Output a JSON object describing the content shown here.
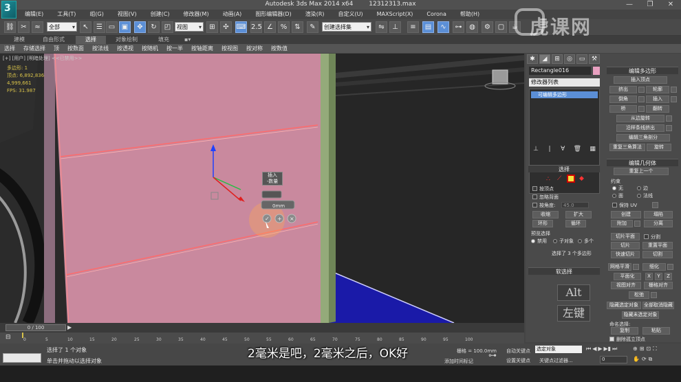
{
  "window": {
    "app_name": "Autodesk 3ds Max  2014 x64",
    "file_name": "12312313.max",
    "minimize": "—",
    "maximize": "❐",
    "close": "✕"
  },
  "menu": [
    "编辑(E)",
    "工具(T)",
    "组(G)",
    "视图(V)",
    "创建(C)",
    "修改器(M)",
    "动画(A)",
    "图形编辑器(D)",
    "渲染(R)",
    "自定义(U)",
    "MAXScript(X)",
    "Corona",
    "帮助(H)"
  ],
  "toolbar": {
    "selection_filter": "全部",
    "ref_coord": "视图",
    "named_selection": "创建选择集",
    "snap_label": "2.5"
  },
  "ribbon": {
    "tabs": [
      "建模",
      "自由形式",
      "选择",
      "对象绘制",
      "填充"
    ],
    "selected_tab": "选择",
    "tools": [
      "选择",
      "存储选择",
      "顶",
      "按数面",
      "按法线",
      "按透视",
      "按随机",
      "按一半",
      "按轴距离",
      "按视图",
      "按对称",
      "按数值"
    ]
  },
  "viewport": {
    "label": "[+] [用户] [明暗处理] <<已禁用>>",
    "stats": [
      "多边形: 1",
      "顶点:    6,892,836",
      "          4,999,661",
      "FPS:     31.987"
    ],
    "caddy": [
      "插入",
      "-数量"
    ],
    "amount_value": "0mm"
  },
  "command_panel": {
    "object_name": "Rectangle016",
    "modifier_list": "修改器列表",
    "stack_item": "可编辑多边形",
    "object_color": "#e8a0c0",
    "edit_poly_title": "编辑多边形",
    "edit_poly_buttons": [
      "插入顶点",
      "挤出",
      "轮廓",
      "倒角",
      "插入",
      "桥",
      "翻转",
      "从边旋转",
      "沿样条线挤出",
      "编辑三角剖分",
      "重复三角算法",
      "旋转"
    ],
    "edit_geom_title": "编辑几何体",
    "edit_geom_buttons": [
      "重复上一个",
      "约束",
      "无",
      "边",
      "面",
      "法线",
      "保持 UV",
      "创建",
      "塌陷",
      "附加",
      "分离",
      "切片平面",
      "分割",
      "切片",
      "重置平面",
      "快速切片",
      "切割",
      "网格平滑",
      "细化",
      "平面化",
      "X",
      "Y",
      "Z",
      "视图对齐",
      "栅格对齐",
      "松弛",
      "隐藏选定对象",
      "全部取消隐藏",
      "隐藏未选定对象",
      "命名选择:",
      "复制",
      "粘贴",
      "删除孤立顶点"
    ],
    "selection_title": "选择",
    "selection_options": [
      "按顶点",
      "忽略背面",
      "按角度:",
      "45.0",
      "收缩",
      "扩大",
      "环形",
      "循环"
    ],
    "preview_label": "预览选择",
    "preview_options": [
      "禁用",
      "子对象",
      "多个"
    ],
    "selection_status": "选择了 3 个多边形",
    "soft_selection_title": "软选择"
  },
  "key_hints": [
    "Alt",
    "左键"
  ],
  "timeline": {
    "slider": "0 / 100",
    "ticks": [
      "0",
      "5",
      "10",
      "15",
      "20",
      "25",
      "30",
      "35",
      "40",
      "45",
      "50",
      "55",
      "60",
      "65",
      "70",
      "75",
      "80",
      "85",
      "90",
      "95",
      "100"
    ]
  },
  "status": {
    "selected": "选择了 1 个对象",
    "prompt": "单击并拖动以选择对象",
    "grid": "栅格 = 100.0mm",
    "auto_key": "自动关键点",
    "set_key": "设置关键点",
    "selected_obj": "选定对象",
    "key_filter": "关键点过滤器...",
    "add_time_tag": "添加时间标记",
    "frame": "0"
  },
  "subtitle": "2毫米是吧，2毫米之后，OK好",
  "watermark": "虎课网"
}
